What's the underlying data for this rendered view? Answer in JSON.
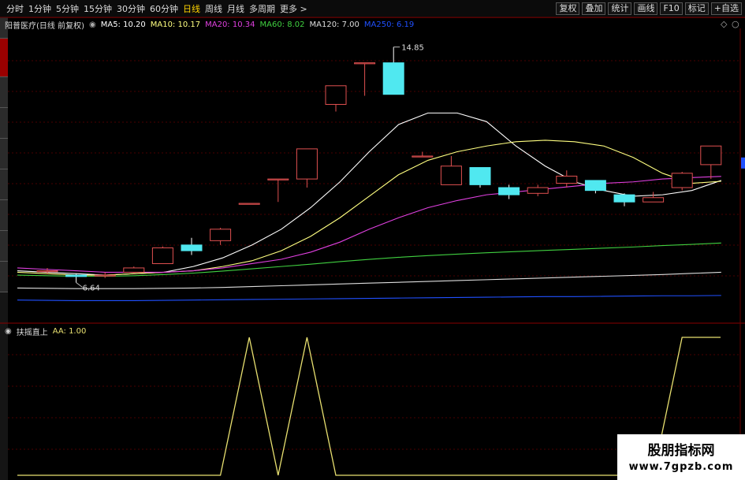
{
  "topbar": {
    "tabs": [
      "分时",
      "1分钟",
      "5分钟",
      "15分钟",
      "30分钟",
      "60分钟",
      "日线",
      "周线",
      "月线",
      "多周期",
      "更多 >"
    ],
    "active_tab": "日线",
    "tools": [
      "复权",
      "叠加",
      "统计",
      "画线",
      "F10",
      "标记",
      "+自选"
    ]
  },
  "price_panel": {
    "title": "阳普医疗(日线 前复权)",
    "ma": [
      {
        "label": "MA5: 10.20",
        "color": "#ffffff"
      },
      {
        "label": "MA10: 10.17",
        "color": "#ffff80"
      },
      {
        "label": "MA20: 10.34",
        "color": "#e040e0"
      },
      {
        "label": "MA60: 8.02",
        "color": "#40d040"
      },
      {
        "label": "MA120: 7.00",
        "color": "#dddddd"
      },
      {
        "label": "MA250: 6.19",
        "color": "#2050ff"
      }
    ],
    "high_label": "14.85",
    "low_label": "6.64"
  },
  "indicator_panel": {
    "title": "扶摇直上",
    "value": "AA: 1.00",
    "color": "#e8e070"
  },
  "chart_data": {
    "type": "candlestick",
    "y_range": [
      5.5,
      15.5
    ],
    "candles": [
      {
        "o": 7.05,
        "c": 7.05,
        "h": 7.15,
        "l": 6.95
      },
      {
        "o": 6.9,
        "c": 6.85,
        "h": 6.95,
        "l": 6.64
      },
      {
        "o": 6.9,
        "c": 6.9,
        "h": 7.0,
        "l": 6.8
      },
      {
        "o": 7.0,
        "c": 7.15,
        "h": 7.2,
        "l": 6.95
      },
      {
        "o": 7.3,
        "c": 7.85,
        "h": 7.9,
        "l": 7.3
      },
      {
        "o": 7.95,
        "c": 7.75,
        "h": 8.2,
        "l": 7.6
      },
      {
        "o": 8.1,
        "c": 8.5,
        "h": 8.55,
        "l": 7.95
      },
      {
        "o": 9.4,
        "c": 9.4,
        "h": 9.4,
        "l": 9.4
      },
      {
        "o": 10.25,
        "c": 10.25,
        "h": 10.25,
        "l": 9.45
      },
      {
        "o": 10.25,
        "c": 11.3,
        "h": 11.3,
        "l": 9.95
      },
      {
        "o": 12.85,
        "c": 13.5,
        "h": 13.5,
        "l": 12.6
      },
      {
        "o": 14.3,
        "c": 14.3,
        "h": 14.3,
        "l": 13.15
      },
      {
        "o": 14.3,
        "c": 13.2,
        "h": 14.85,
        "l": 13.2
      },
      {
        "o": 11.05,
        "c": 11.05,
        "h": 11.2,
        "l": 11.05
      },
      {
        "o": 10.05,
        "c": 10.7,
        "h": 11.05,
        "l": 10.05
      },
      {
        "o": 10.65,
        "c": 10.05,
        "h": 10.65,
        "l": 9.95
      },
      {
        "o": 9.95,
        "c": 9.7,
        "h": 10.05,
        "l": 9.55
      },
      {
        "o": 9.75,
        "c": 9.95,
        "h": 10.05,
        "l": 9.65
      },
      {
        "o": 10.1,
        "c": 10.35,
        "h": 10.55,
        "l": 9.95
      },
      {
        "o": 10.2,
        "c": 9.85,
        "h": 10.2,
        "l": 9.75
      },
      {
        "o": 9.7,
        "c": 9.45,
        "h": 9.75,
        "l": 9.3
      },
      {
        "o": 9.45,
        "c": 9.6,
        "h": 9.8,
        "l": 9.45
      },
      {
        "o": 9.95,
        "c": 10.45,
        "h": 10.5,
        "l": 9.85
      },
      {
        "o": 10.75,
        "c": 11.4,
        "h": 11.4,
        "l": 10.25
      }
    ],
    "ma_series": {
      "MA5": [
        7.05,
        7.0,
        6.95,
        6.9,
        6.95,
        7.0,
        7.2,
        7.5,
        7.95,
        8.5,
        9.25,
        10.15,
        11.2,
        12.15,
        12.55,
        12.55,
        12.25,
        11.4,
        10.7,
        10.15,
        9.85,
        9.65,
        9.7,
        9.85,
        10.2
      ],
      "MA10": [
        7.0,
        6.95,
        6.9,
        6.9,
        6.95,
        7.0,
        7.05,
        7.2,
        7.4,
        7.75,
        8.25,
        8.9,
        9.65,
        10.4,
        10.9,
        11.2,
        11.4,
        11.55,
        11.6,
        11.55,
        11.4,
        11.0,
        10.45,
        10.1,
        10.17
      ],
      "MA20": [
        7.15,
        7.1,
        7.05,
        7.0,
        7.0,
        7.0,
        7.05,
        7.15,
        7.3,
        7.45,
        7.7,
        8.05,
        8.5,
        8.9,
        9.25,
        9.5,
        9.7,
        9.8,
        9.9,
        10.0,
        10.1,
        10.15,
        10.25,
        10.3,
        10.34
      ],
      "MA60": [
        6.9,
        6.88,
        6.86,
        6.86,
        6.88,
        6.92,
        6.97,
        7.04,
        7.12,
        7.2,
        7.28,
        7.37,
        7.45,
        7.52,
        7.58,
        7.63,
        7.68,
        7.72,
        7.76,
        7.8,
        7.84,
        7.88,
        7.93,
        7.97,
        8.02
      ],
      "MA120": [
        6.45,
        6.44,
        6.43,
        6.43,
        6.43,
        6.44,
        6.45,
        6.47,
        6.5,
        6.53,
        6.56,
        6.59,
        6.62,
        6.65,
        6.68,
        6.71,
        6.74,
        6.77,
        6.8,
        6.83,
        6.86,
        6.89,
        6.92,
        6.96,
        7.0
      ],
      "MA250": [
        6.03,
        6.02,
        6.01,
        6.01,
        6.01,
        6.02,
        6.03,
        6.04,
        6.05,
        6.06,
        6.07,
        6.08,
        6.09,
        6.1,
        6.11,
        6.12,
        6.13,
        6.14,
        6.15,
        6.15,
        6.16,
        6.17,
        6.18,
        6.18,
        6.19
      ]
    },
    "AA": [
      0,
      0,
      0,
      0,
      0,
      0,
      0,
      1,
      0,
      1,
      0,
      0,
      0,
      0,
      0,
      0,
      0,
      0,
      0,
      0,
      0,
      0,
      1,
      1
    ]
  },
  "watermark": {
    "line1": "股朋指标网",
    "line2": "www.7gpzb.com"
  }
}
